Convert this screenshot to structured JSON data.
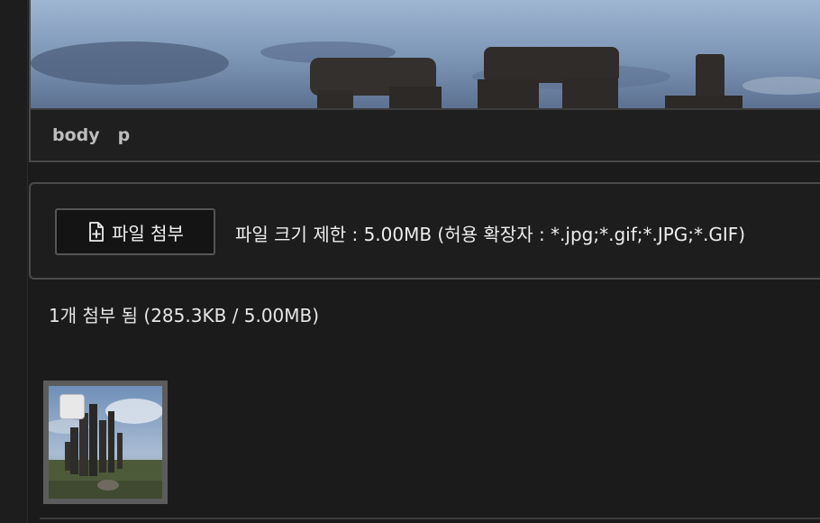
{
  "editor": {
    "path_tags": [
      "body",
      "p"
    ]
  },
  "upload": {
    "attach_button_label": "파일 첨부",
    "attach_icon": "file-plus-icon",
    "limit_text": "파일 크기 제한 : 5.00MB (허용 확장자 : *.jpg;*.gif;*.JPG;*.GIF)"
  },
  "attachments": {
    "summary": "1개 첨부 됨 (285.3KB / 5.00MB)",
    "items": [
      {
        "checked": false
      }
    ]
  }
}
